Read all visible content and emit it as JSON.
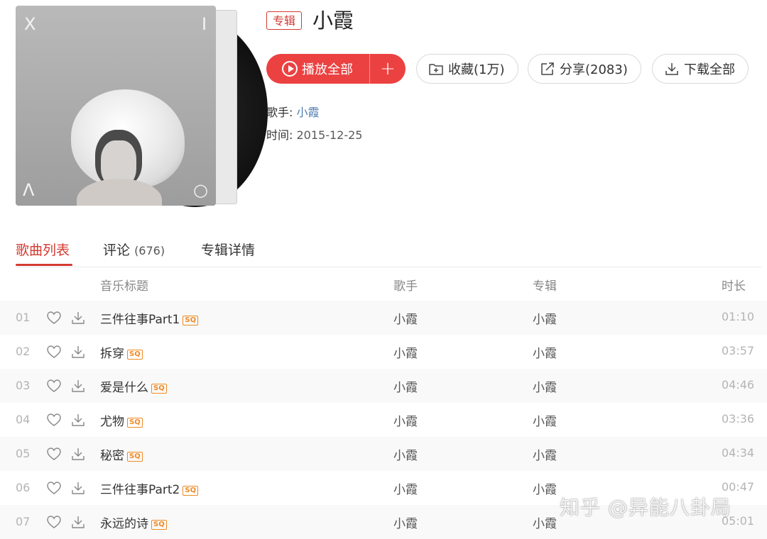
{
  "album": {
    "type_badge": "专辑",
    "title": "小霞",
    "cover_marks": {
      "top_left": "X",
      "top_right": "I",
      "bottom_left": "Λ",
      "bottom_right": "○"
    }
  },
  "actions": {
    "play_all": "播放全部",
    "add": "+",
    "collect": "收藏(1万)",
    "share": "分享(2083)",
    "download_all": "下载全部"
  },
  "meta": {
    "artist_label": "歌手:",
    "artist_value": "小霞",
    "time_label": "时间:",
    "time_value": "2015-12-25"
  },
  "tabs": [
    {
      "label": "歌曲列表",
      "count": ""
    },
    {
      "label": "评论",
      "count": "(676)"
    },
    {
      "label": "专辑详情",
      "count": ""
    }
  ],
  "table": {
    "headers": {
      "title": "音乐标题",
      "artist": "歌手",
      "album": "专辑",
      "duration": "时长"
    },
    "quality_badge": "SQ",
    "rows": [
      {
        "num": "01",
        "title": "三件往事Part1",
        "artist": "小霞",
        "album": "小霞",
        "duration": "01:10"
      },
      {
        "num": "02",
        "title": "拆穿",
        "artist": "小霞",
        "album": "小霞",
        "duration": "03:57"
      },
      {
        "num": "03",
        "title": "爱是什么",
        "artist": "小霞",
        "album": "小霞",
        "duration": "04:46"
      },
      {
        "num": "04",
        "title": "尤物",
        "artist": "小霞",
        "album": "小霞",
        "duration": "03:36"
      },
      {
        "num": "05",
        "title": "秘密",
        "artist": "小霞",
        "album": "小霞",
        "duration": "04:34"
      },
      {
        "num": "06",
        "title": "三件往事Part2",
        "artist": "小霞",
        "album": "小霞",
        "duration": "00:47"
      },
      {
        "num": "07",
        "title": "永远的诗",
        "artist": "小霞",
        "album": "小霞",
        "duration": "05:01"
      }
    ]
  },
  "watermark": "知乎 @异能八卦局",
  "colors": {
    "accent": "#ec4141",
    "badge_red": "#d33a31",
    "sq_orange": "#f08a24",
    "link": "#507daf"
  }
}
